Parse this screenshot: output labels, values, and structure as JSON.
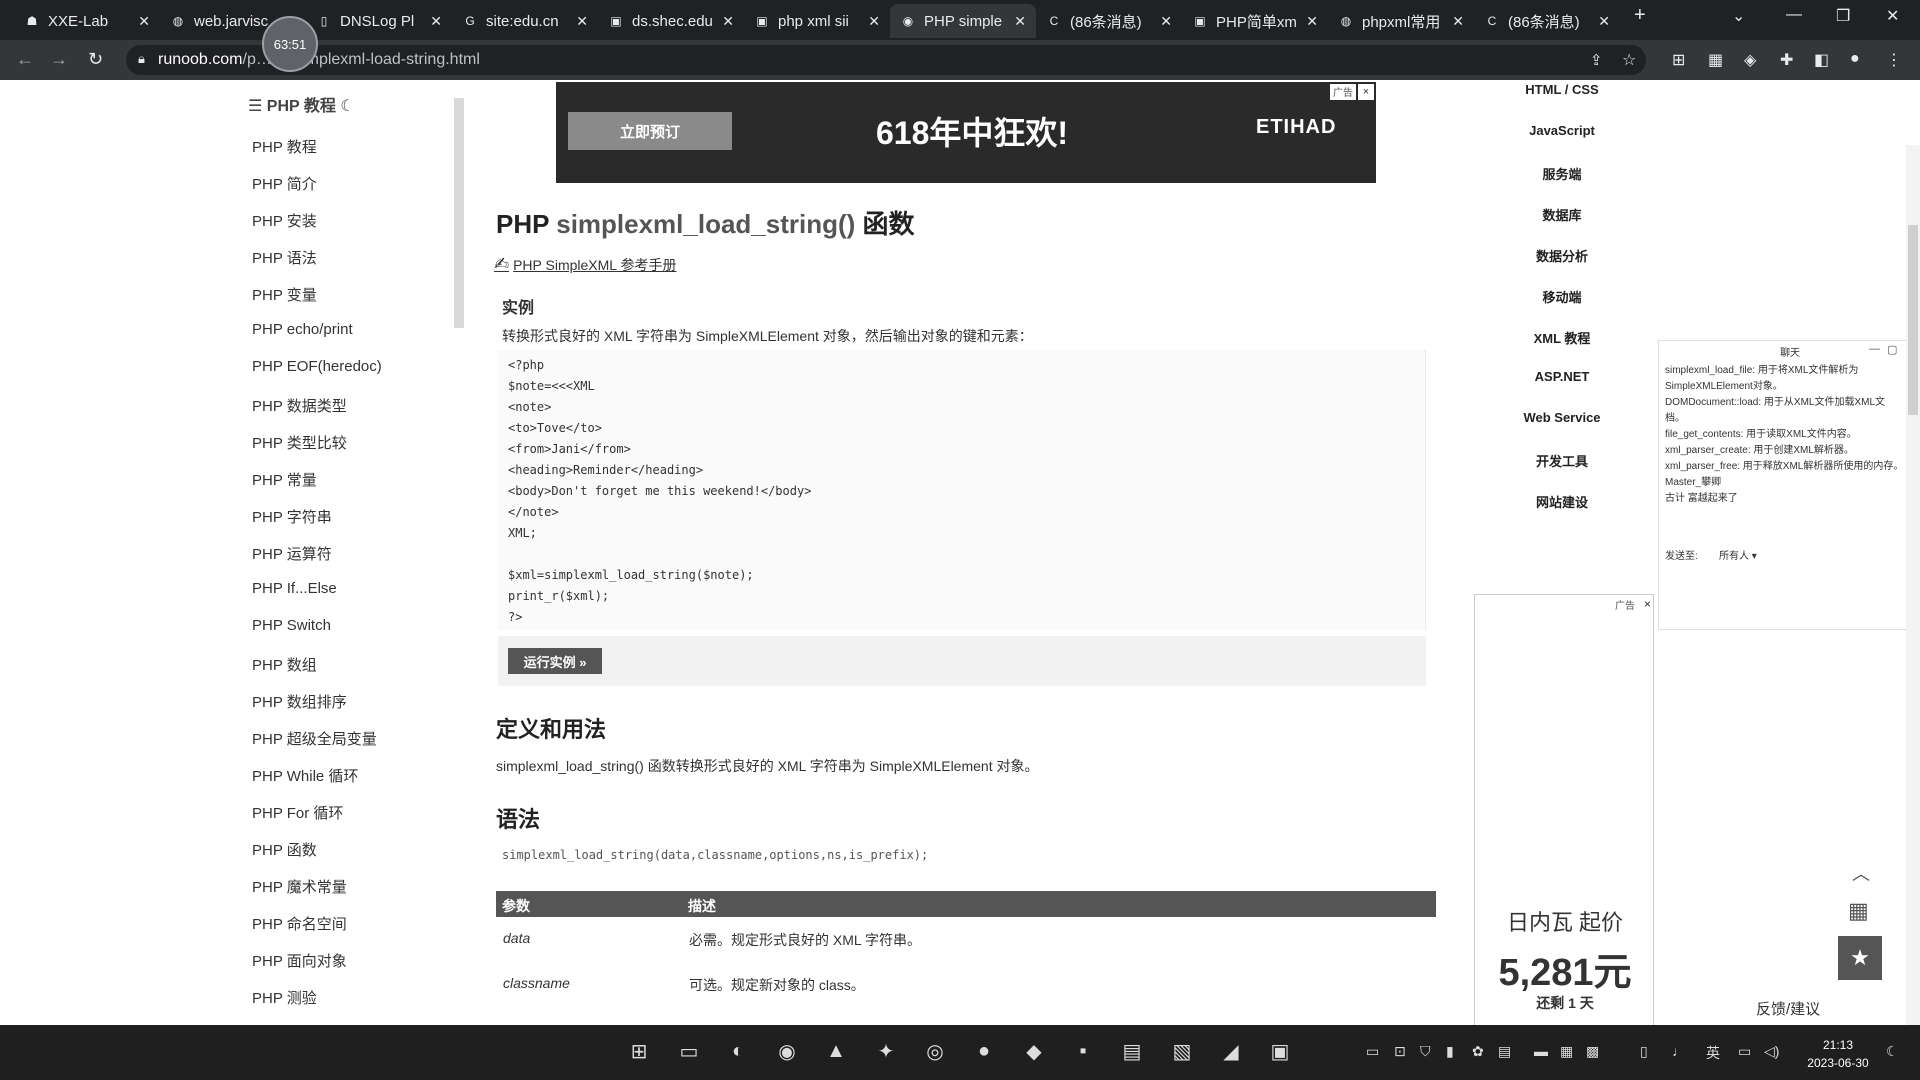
{
  "browser": {
    "tabs": [
      {
        "label": "XXE-Lab",
        "icon": "ghost-icon"
      },
      {
        "label": "web.jarvisc",
        "icon": "globe-icon"
      },
      {
        "label": "DNSLog Pl",
        "icon": "doc-icon"
      },
      {
        "label": "site:edu.cn",
        "icon": "google-icon"
      },
      {
        "label": "ds.shec.edu",
        "icon": "site-icon"
      },
      {
        "label": "php xml sii",
        "icon": "site-icon"
      },
      {
        "label": "PHP simple",
        "icon": "runoob-icon"
      },
      {
        "label": "(86条消息)",
        "icon": "csdn-icon"
      },
      {
        "label": "PHP简单xm",
        "icon": "site-icon"
      },
      {
        "label": "phpxml常用",
        "icon": "globe-icon"
      },
      {
        "label": "(86条消息)",
        "icon": "csdn-icon"
      }
    ],
    "active_tab_index": 6,
    "url_host": "runoob.com",
    "url_path": "/p…nc-simplexml-load-string.html",
    "timer": "63:51"
  },
  "sidebar": {
    "header": "PHP 教程",
    "items": [
      "PHP 教程",
      "PHP 简介",
      "PHP 安装",
      "PHP 语法",
      "PHP 变量",
      "PHP echo/print",
      "PHP EOF(heredoc)",
      "PHP 数据类型",
      "PHP 类型比较",
      "PHP 常量",
      "PHP 字符串",
      "PHP 运算符",
      "PHP If...Else",
      "PHP Switch",
      "PHP 数组",
      "PHP 数组排序",
      "PHP 超级全局变量",
      "PHP While 循环",
      "PHP For 循环",
      "PHP 函数",
      "PHP 魔术常量",
      "PHP 命名空间",
      "PHP 面向对象",
      "PHP 测验"
    ]
  },
  "top_ad": {
    "button": "立即预订",
    "headline": "618年中狂欢!",
    "brand": "ETIHAD",
    "tag": "广告",
    "close": "×"
  },
  "main": {
    "title_prefix": "PHP",
    "title_fn": "simplexml_load_string()",
    "title_suffix": "函数",
    "ref_link": "PHP SimpleXML 参考手册",
    "example_label": "实例",
    "example_desc": "转换形式良好的 XML 字符串为 SimpleXMLElement 对象，然后输出对象的键和元素：",
    "code_lines": [
      "<?php",
      "$note=<<<XML",
      "<note>",
      "<to>Tove</to>",
      "<from>Jani</from>",
      "<heading>Reminder</heading>",
      "<body>Don't forget me this weekend!</body>",
      "</note>",
      "XML;",
      "",
      "$xml=simplexml_load_string($note);",
      "print_r($xml);",
      "?>"
    ],
    "run_button": "运行实例 »",
    "def_title": "定义和用法",
    "def_text": "simplexml_load_string() 函数转换形式良好的 XML 字符串为 SimpleXMLElement 对象。",
    "syntax_title": "语法",
    "syntax_text": "simplexml_load_string(data,classname,options,ns,is_prefix);",
    "table_headers": [
      "参数",
      "描述"
    ],
    "table_rows": [
      {
        "name": "data",
        "desc": "必需。规定形式良好的 XML 字符串。"
      },
      {
        "name": "classname",
        "desc": "可选。规定新对象的 class。"
      }
    ]
  },
  "right_nav": [
    "HTML / CSS",
    "JavaScript",
    "服务端",
    "数据库",
    "数据分析",
    "移动端",
    "XML 教程",
    "ASP.NET",
    "Web Service",
    "开发工具",
    "网站建设"
  ],
  "right_ad": {
    "tag": "广告",
    "close": "×",
    "line1": "日内瓦 起价",
    "line2": "5,281元",
    "line3": "还剩 1 天"
  },
  "float_panel": {
    "title": "聊天",
    "lines": [
      "simplexml_load_file: 用于将XML文件解析为",
      "SimpleXMLElement对象。",
      "DOMDocument::load: 用于从XML文件加载XML文",
      "档。",
      "file_get_contents: 用于读取XML文件内容。",
      "xml_parser_create: 用于创建XML解析器。",
      "xml_parser_free: 用于释放XML解析器所使用的内存。",
      "Master_攀卿",
      "古计 富越起来了"
    ],
    "send_to_label": "发送至:",
    "send_to_value": "所有人 ▾"
  },
  "feedback": "反馈/建议",
  "clock": {
    "time": "21:13",
    "date": "2023-06-30"
  },
  "tray_lang": "英"
}
